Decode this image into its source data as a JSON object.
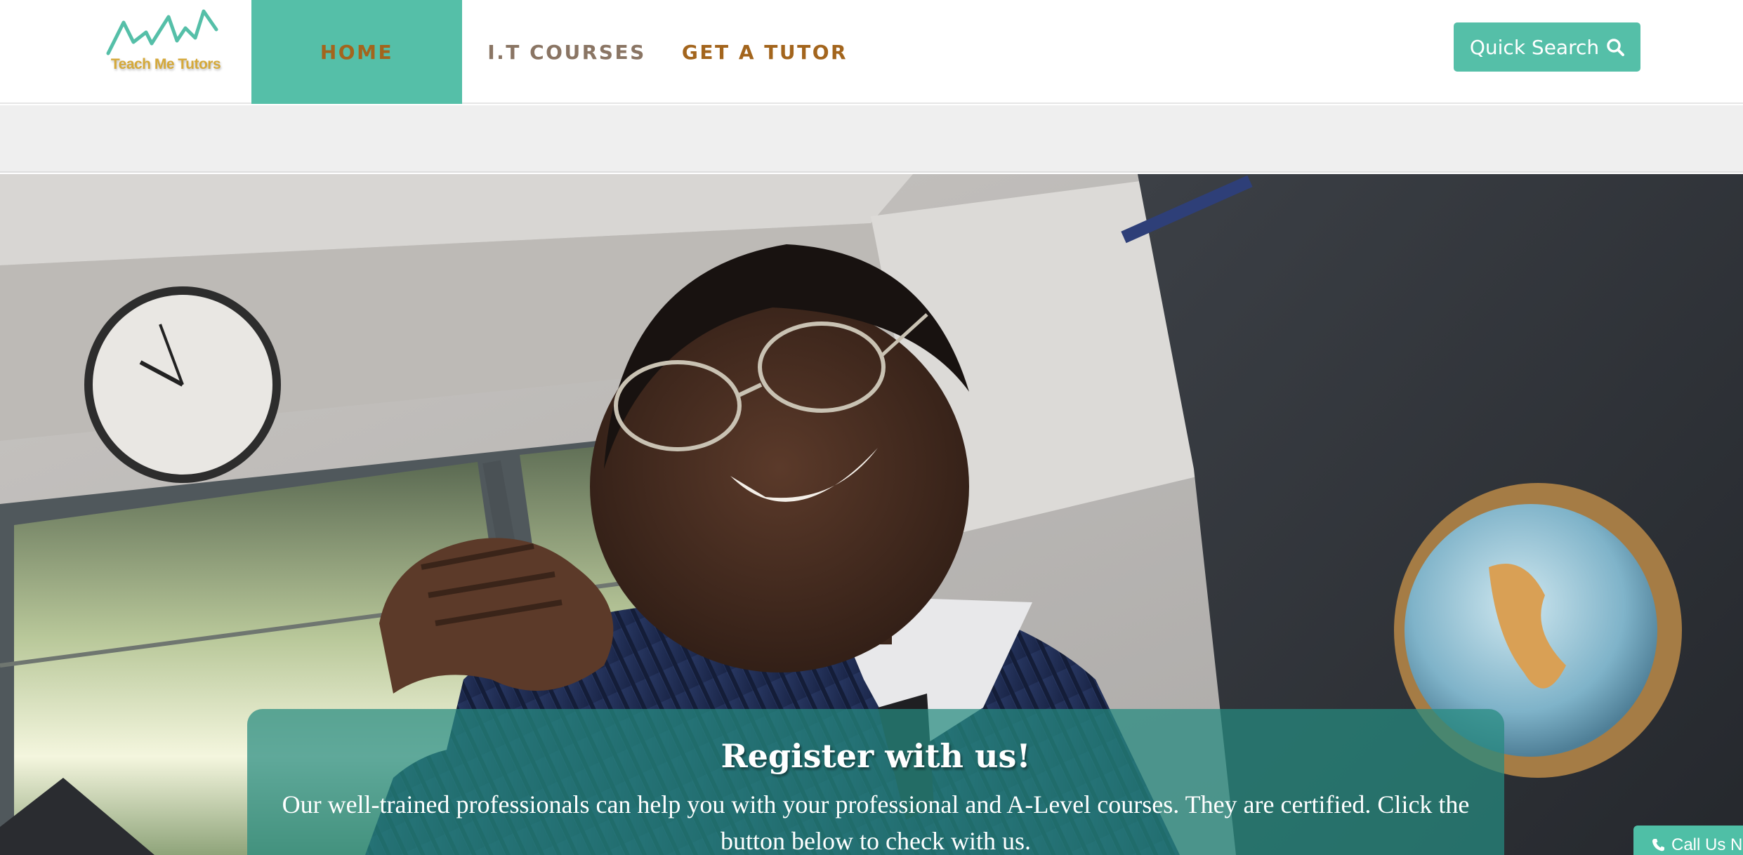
{
  "header": {
    "logo_text": "Teach Me Tutors",
    "nav": [
      {
        "label": "HOME",
        "active": true
      },
      {
        "label": "I.T COURSES",
        "active": false
      },
      {
        "label": "GET A TUTOR",
        "active": false
      }
    ],
    "quick_search_label": "Quick Search",
    "quick_search_icon": "search-icon"
  },
  "hero": {
    "image_description_icon": "hero-photo",
    "register": {
      "title": "Register with us!",
      "text": "Our well-trained professionals can help you with your professional and A-Level courses. They are certified. Click the button below to check with us."
    }
  },
  "call_us": {
    "label": "Call Us No",
    "icon": "phone-icon"
  },
  "colors": {
    "accent": "#55bfa8",
    "nav_text_brown": "#a3651d",
    "nav_text_muted": "#8a7564",
    "logo_gold": "#d5a93a",
    "register_overlay": "#268a80"
  }
}
